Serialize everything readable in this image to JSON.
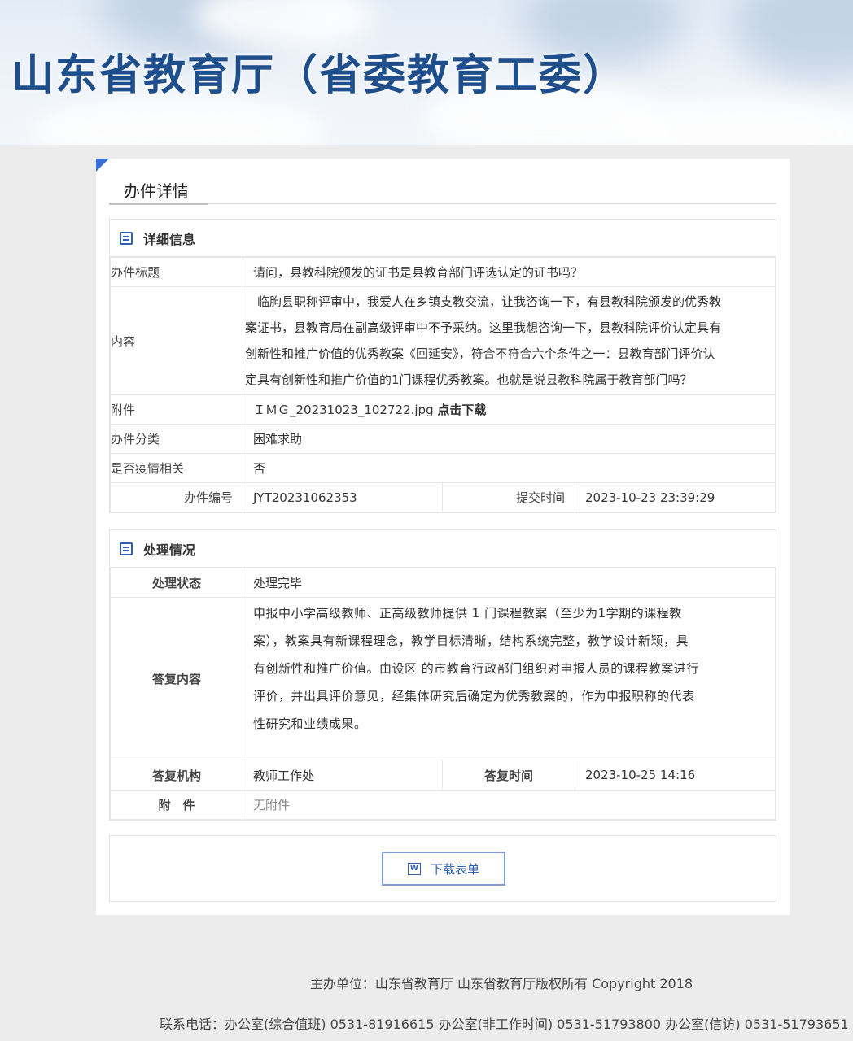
{
  "header": {
    "title": "山东省教育厅（省委教育工委）"
  },
  "page": {
    "title": "办件详情"
  },
  "details": {
    "heading": "详细信息",
    "subject_label": "办件标题",
    "subject": "请问，县教科院颁发的证书是县教育部门评选认定的证书吗？",
    "content_label": "内容",
    "content_lines": [
      "　临朐县职称评审中，我爱人在乡镇支教交流，让我咨询一下，有县教科院颁发的优秀教",
      "案证书，县教育局在副高级评审中不予采纳。这里我想咨询一下，县教科院评价认定具有",
      "创新性和推广价值的优秀教案《回延安》，符合不符合六个条件之一：县教育部门评价认",
      "定具有创新性和推广价值的1门课程优秀教案。也就是说县教科院属于教育部门吗？"
    ],
    "attachment_label": "附件",
    "attachment_file": "ＩＭＧ_20231023_102722.jpg",
    "attachment_download": "点击下载",
    "category_label": "办件分类",
    "category": "困难求助",
    "epidemic_label": "是否疫情相关",
    "epidemic": "否",
    "number_label": "办件编号",
    "number": "JYT20231062353",
    "submit_time_label": "提交时间",
    "submit_time": "2023-10-23 23:39:29"
  },
  "processing": {
    "heading": "处理情况",
    "status_label": "处理状态",
    "status": "处理完毕",
    "reply_label": "答复内容",
    "reply_lines": [
      "申报中小学高级教师、正高级教师提供 1 门课程教案（至少为1学期的课程教",
      "案），教案具有新课程理念，教学目标清晰，结构系统完整，教学设计新颖，具",
      "有创新性和推广价值。由设区 的市教育行政部门组织对申报人员的课程教案进行",
      "评价，并出具评价意见，经集体研究后确定为优秀教案的，作为申报职称的代表",
      "性研究和业绩成果。"
    ],
    "org_label": "答复机构",
    "org": "教师工作处",
    "reply_time_label": "答复时间",
    "reply_time": "2023-10-25 14:16",
    "attachment_label": "附　件",
    "attachment": "无附件"
  },
  "download": {
    "icon": "W",
    "label": "下载表单"
  },
  "footer": {
    "line1": "主办单位：山东省教育厅 山东省教育厅版权所有 Copyright 2018",
    "line2": "联系电话：办公室(综合值班) 0531-81916615  办公室(非工作时间) 0531-51793800  办公室(信访) 0531-51793651"
  }
}
